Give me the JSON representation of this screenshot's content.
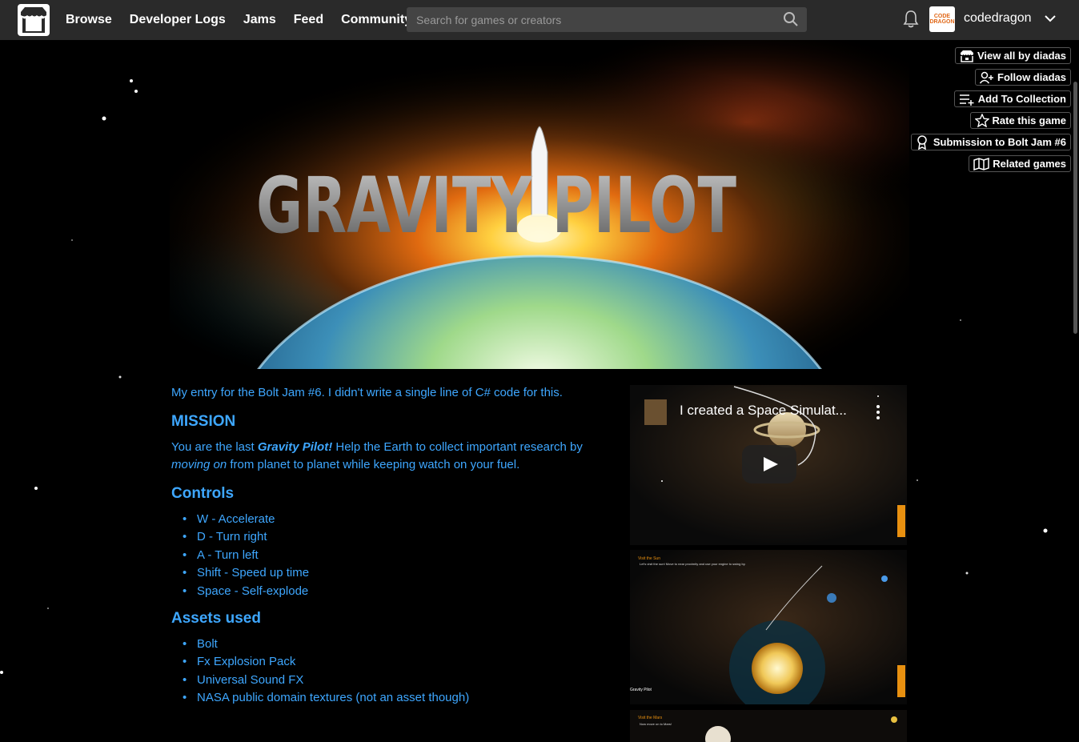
{
  "nav": {
    "items": [
      "Browse",
      "Developer Logs",
      "Jams",
      "Feed",
      "Community"
    ],
    "search_placeholder": "Search for games or creators"
  },
  "user": {
    "avatar_text": "CODE DRAGON",
    "name": "codedragon"
  },
  "game": {
    "banner_title": "GRAVITY PILOT"
  },
  "side_buttons": [
    {
      "label": "View all by diadas",
      "icon": "itchio-icon"
    },
    {
      "label": "Follow diadas",
      "icon": "user-plus-icon"
    },
    {
      "label": "Add To Collection",
      "icon": "list-plus-icon"
    },
    {
      "label": "Rate this game",
      "icon": "star-icon"
    },
    {
      "label": "Submission to Bolt Jam #6",
      "icon": "award-icon"
    },
    {
      "label": "Related games",
      "icon": "map-icon"
    }
  ],
  "description": {
    "intro": "My entry for the Bolt Jam #6. I didn't write a single line of C# code for this.",
    "mission_heading": "MISSION",
    "mission_p1": "You are the last ",
    "mission_em1": "Gravity Pilot!",
    "mission_p2": " Help the Earth to collect important research by ",
    "mission_em2": "moving on",
    "mission_p3": " from planet to planet while keeping watch on your fuel.",
    "controls_heading": "Controls",
    "controls": [
      "W - Accelerate",
      "D  - Turn right",
      "A - Turn left",
      "Shift - Speed up time",
      "Space - Self-explode"
    ],
    "assets_heading": "Assets used",
    "assets": [
      "Bolt",
      "Fx Explosion Pack",
      "Universal Sound FX",
      "NASA public domain textures (not an asset though)"
    ]
  },
  "video": {
    "title": "I created a Space Simulat..."
  },
  "screenshots": [
    {
      "caption": "Visit the Sun",
      "text": "Let's visit the sun! Move to near proximity and use your engine to swing by.",
      "footer": "Gravity Pilot"
    },
    {
      "caption": "Visit the Mars",
      "text": "Now move on to Mars!"
    }
  ],
  "colors": {
    "topbar": "#2a2a2a",
    "link": "#3ea7ff",
    "background": "#000000"
  }
}
